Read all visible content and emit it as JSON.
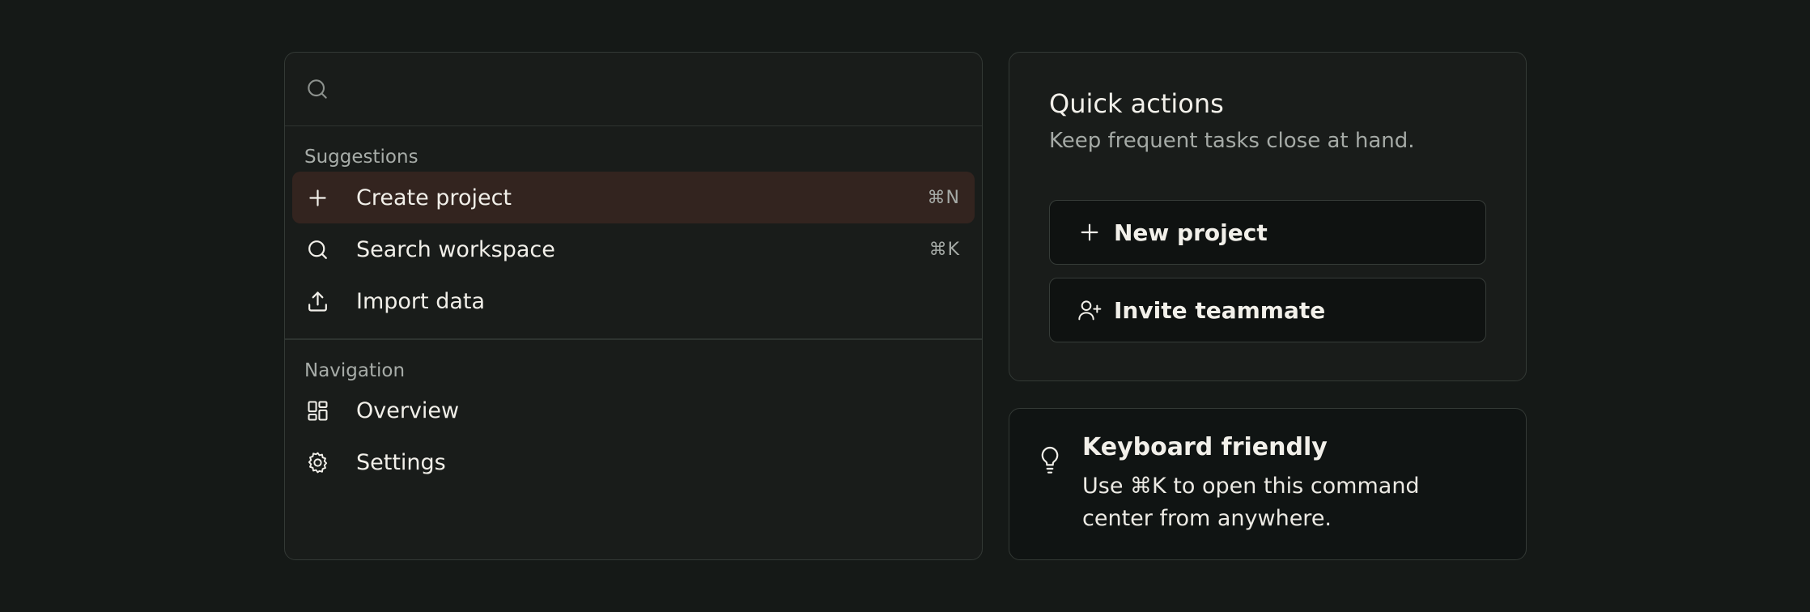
{
  "palette": {
    "search": {
      "placeholder": "",
      "value": ""
    },
    "groups": [
      {
        "label": "Suggestions",
        "items": [
          {
            "label": "Create project",
            "shortcut": "⌘N",
            "icon": "plus-icon",
            "active": true
          },
          {
            "label": "Search workspace",
            "shortcut": "⌘K",
            "icon": "search-icon",
            "active": false
          },
          {
            "label": "Import data",
            "shortcut": "",
            "icon": "upload-icon",
            "active": false
          }
        ]
      },
      {
        "label": "Navigation",
        "items": [
          {
            "label": "Overview",
            "shortcut": "",
            "icon": "dashboard-icon",
            "active": false
          },
          {
            "label": "Settings",
            "shortcut": "",
            "icon": "gear-icon",
            "active": false
          }
        ]
      }
    ]
  },
  "quick_actions": {
    "title": "Quick actions",
    "subtitle": "Keep frequent tasks close at hand.",
    "buttons": [
      {
        "label": "New project",
        "icon": "plus-icon"
      },
      {
        "label": "Invite teammate",
        "icon": "user-plus-icon"
      }
    ]
  },
  "tip": {
    "icon": "lightbulb-icon",
    "title": "Keyboard friendly",
    "text": "Use ⌘K to open this command center from anywhere."
  },
  "colors": {
    "background": "#151917",
    "panel": "#191c1a",
    "active_item": "#33241f",
    "button": "#0f1211",
    "muted_text": "#a5aaa6"
  }
}
